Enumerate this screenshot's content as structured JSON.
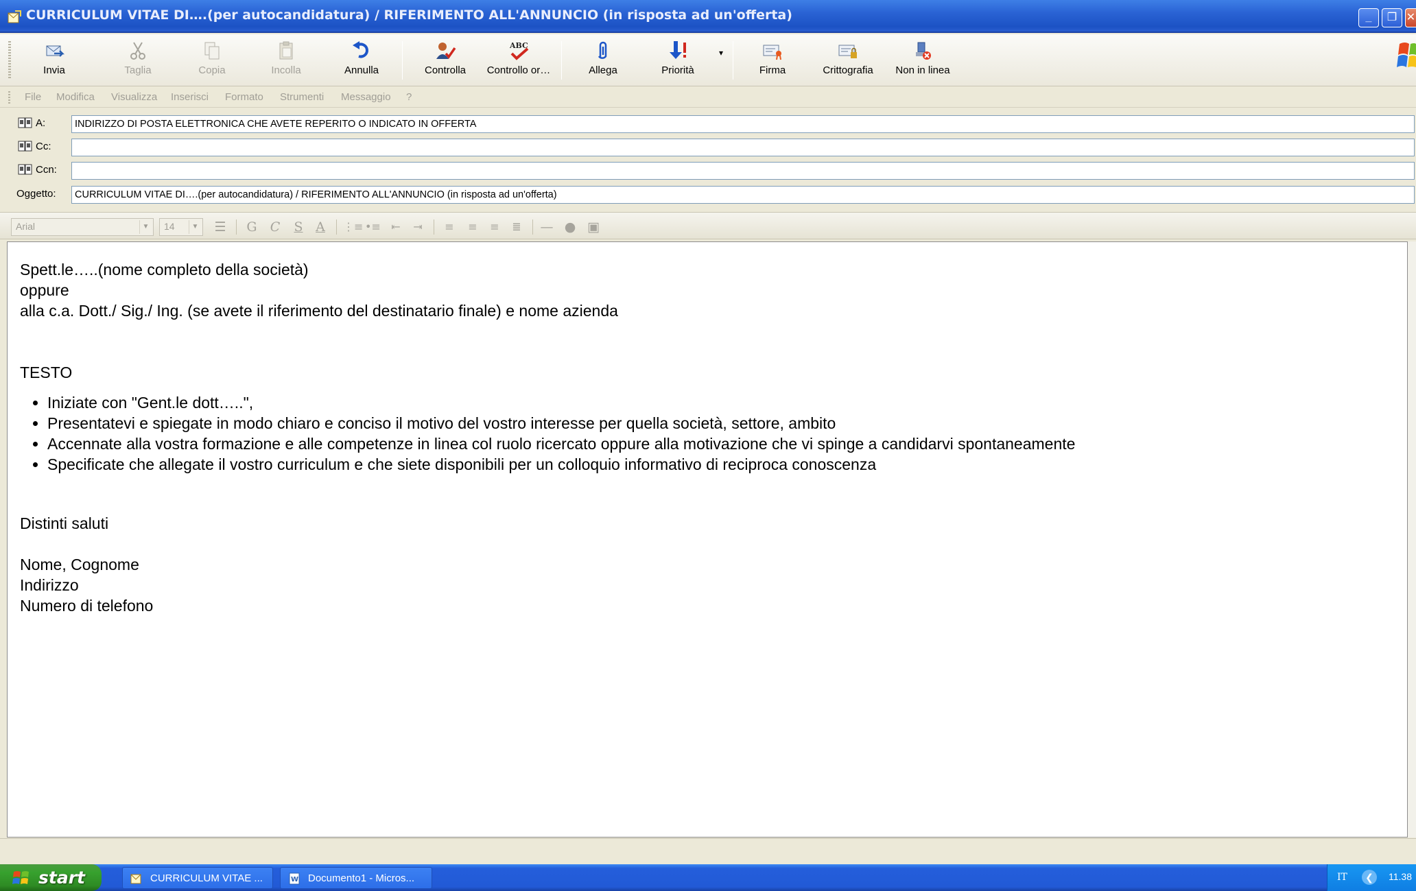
{
  "window": {
    "title": "CURRICULUM VITAE DI….(per autocandidatura) / RIFERIMENTO ALL'ANNUNCIO (in risposta ad un'offerta)"
  },
  "toolbar": {
    "buttons": [
      {
        "label": "Invia",
        "icon": "send-icon",
        "enabled": true
      },
      {
        "label": "Taglia",
        "icon": "scissors-icon",
        "enabled": false
      },
      {
        "label": "Copia",
        "icon": "copy-icon",
        "enabled": false
      },
      {
        "label": "Incolla",
        "icon": "paste-icon",
        "enabled": false
      },
      {
        "label": "Annulla",
        "icon": "undo-icon",
        "enabled": true
      },
      {
        "label": "Controlla",
        "icon": "check-names-icon",
        "enabled": true
      },
      {
        "label": "Controllo or…",
        "icon": "spelling-icon",
        "enabled": true
      },
      {
        "label": "Allega",
        "icon": "paperclip-icon",
        "enabled": true
      },
      {
        "label": "Priorità",
        "icon": "priority-icon",
        "enabled": true
      },
      {
        "label": "Firma",
        "icon": "signature-icon",
        "enabled": true
      },
      {
        "label": "Crittografia",
        "icon": "encrypt-icon",
        "enabled": true
      },
      {
        "label": "Non in linea",
        "icon": "offline-icon",
        "enabled": true
      }
    ]
  },
  "menu": {
    "items": [
      "File",
      "Modifica",
      "Visualizza",
      "Inserisci",
      "Formato",
      "Strumenti",
      "Messaggio",
      "?"
    ]
  },
  "header": {
    "to_label": "A:",
    "to_value": "INDIRIZZO DI POSTA ELETTRONICA CHE AVETE REPERITO O INDICATO IN OFFERTA",
    "cc_label": "Cc:",
    "cc_value": "",
    "bcc_label": "Ccn:",
    "bcc_value": "",
    "subject_label": "Oggetto:",
    "subject_value": "CURRICULUM VITAE DI….(per autocandidatura) / RIFERIMENTO ALL'ANNUNCIO (in risposta ad un'offerta)"
  },
  "format": {
    "font": "Arial",
    "size": "14",
    "bold_glyph": "G",
    "italic_glyph": "C",
    "underline_glyph": "S",
    "color_glyph": "A"
  },
  "body": {
    "greeting_lines": [
      "Spett.le…..(nome completo della società)",
      "oppure",
      "alla c.a. Dott./ Sig./ Ing. (se avete il riferimento del destinatario finale) e nome azienda"
    ],
    "section_title": "TESTO",
    "bullets": [
      "Iniziate con \"Gent.le dott…..\",",
      "Presentatevi e spiegate in modo chiaro e conciso il motivo del vostro interesse per quella società, settore, ambito",
      "Accennate alla vostra formazione e alle competenze in linea col ruolo ricercato oppure alla motivazione che vi spinge a candidarvi spontaneamente",
      "Specificate che allegate il vostro curriculum e che siete disponibili per un colloquio informativo di reciproca conoscenza"
    ],
    "closing": "Distinti saluti",
    "signature_lines": [
      "Nome, Cognome",
      "Indirizzo",
      "Numero di telefono"
    ]
  },
  "taskbar": {
    "start_label": "start",
    "tasks": [
      "CURRICULUM VITAE ...",
      "Documento1 - Micros..."
    ],
    "language": "IT",
    "time": "11.38"
  }
}
